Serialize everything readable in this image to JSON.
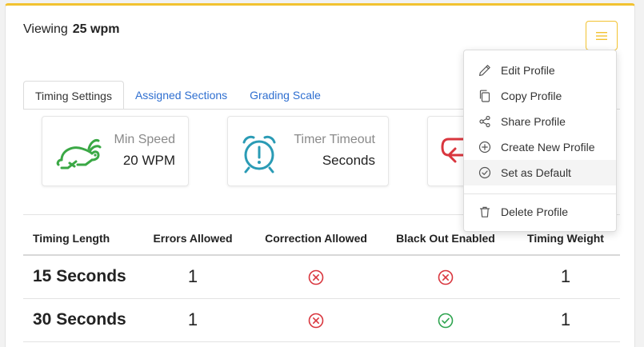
{
  "header": {
    "viewing_label": "Viewing",
    "profile_name": "25 wpm"
  },
  "tabs": [
    {
      "label": "Timing Settings",
      "active": true
    },
    {
      "label": "Assigned Sections",
      "active": false
    },
    {
      "label": "Grading Scale",
      "active": false
    }
  ],
  "stats": {
    "min_speed": {
      "label": "Min Speed",
      "value": "20 WPM",
      "icon": "rabbit-icon"
    },
    "timer_timeout": {
      "label": "Timer Timeout",
      "value": "Seconds",
      "icon": "alarm-clock-icon"
    },
    "third": {
      "icon": "exit-arrow-icon"
    }
  },
  "table": {
    "headers": [
      "Timing Length",
      "Errors Allowed",
      "Correction Allowed",
      "Black Out Enabled",
      "Timing Weight"
    ],
    "rows": [
      {
        "length": "15 Seconds",
        "errors": "1",
        "correction": false,
        "blackout": false,
        "weight": "1"
      },
      {
        "length": "30 Seconds",
        "errors": "1",
        "correction": false,
        "blackout": true,
        "weight": "1"
      }
    ]
  },
  "menu": {
    "items": [
      {
        "label": "Edit Profile",
        "icon": "pencil-icon"
      },
      {
        "label": "Copy Profile",
        "icon": "copy-icon"
      },
      {
        "label": "Share Profile",
        "icon": "share-icon"
      },
      {
        "label": "Create New Profile",
        "icon": "plus-circle-icon"
      },
      {
        "label": "Set as Default",
        "icon": "check-circle-icon"
      }
    ],
    "delete_label": "Delete Profile",
    "delete_icon": "trash-icon"
  },
  "colors": {
    "accent": "#f2c230",
    "link": "#2f6fd0",
    "error": "#d9363e",
    "success": "#2ea44f",
    "rabbit": "#3aa845",
    "clock": "#2a9bb5"
  }
}
